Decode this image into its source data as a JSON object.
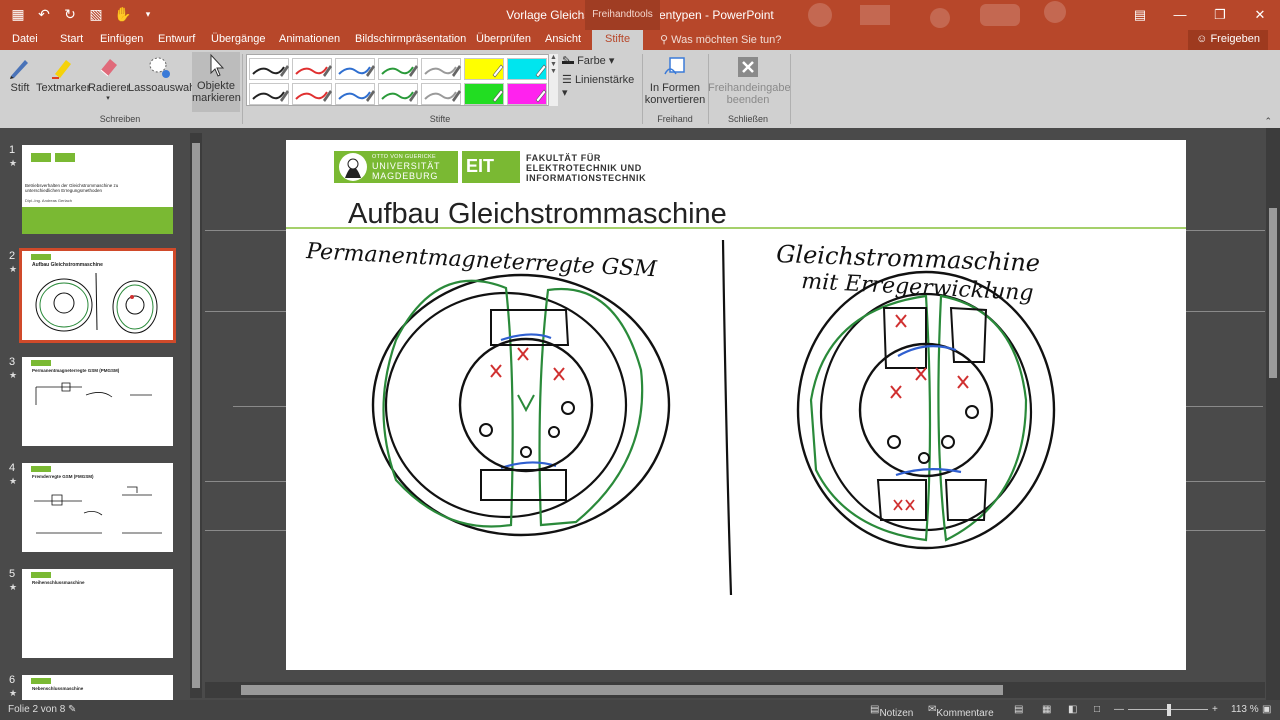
{
  "window": {
    "title": "Vorlage Gleichstrommaschinentypen  -  PowerPoint",
    "context_tab": "Freihandtools"
  },
  "menu": {
    "tabs": [
      "Datei",
      "Start",
      "Einfügen",
      "Entwurf",
      "Übergänge",
      "Animationen",
      "Bildschirmpräsentation",
      "Überprüfen",
      "Ansicht",
      "Stifte"
    ],
    "active_tab": "Stifte",
    "tell_me": "Was möchten Sie tun?",
    "share": "Freigeben"
  },
  "ribbon": {
    "stift": "Stift",
    "textmarker": "Textmarker",
    "radierer": "Radierer",
    "lasso": "Lassoauswahl",
    "objekte_1": "Objekte",
    "objekte_2": "markieren",
    "group_schreiben": "Schreiben",
    "farbe": "Farbe",
    "linienstaerke": "Linienstärke",
    "group_stifte": "Stifte",
    "formen_1": "In Formen",
    "formen_2": "konvertieren",
    "group_freihand": "Freihand",
    "beenden_1": "Freihandeingabe",
    "beenden_2": "beenden",
    "group_schliessen": "Schließen"
  },
  "pen_colors": [
    "#222222",
    "#e03030",
    "#2f6fd0",
    "#2a9a3a",
    "#9a9a9a",
    "#ffff00",
    "#00e5ee",
    "#222222",
    "#e03030",
    "#2f6fd0",
    "#2a9a3a",
    "#9a9a9a",
    "#22dd22",
    "#ff22ee"
  ],
  "thumbnails": [
    {
      "num": "1",
      "star": "★",
      "text_1": "Betriebsverhalten der Gleichstrommaschine zu unterschiedlichen Erregungsmethoden",
      "text_2": "Dipl.-Ing. Andreas Gerlach"
    },
    {
      "num": "2",
      "star": "★",
      "text_1": "Aufbau Gleichstrommaschine"
    },
    {
      "num": "3",
      "star": "★",
      "text_1": "Permanentmagneterregte GSM (PMGSM)"
    },
    {
      "num": "4",
      "star": "★",
      "text_1": "Fremderregte GSM (FMGSM)"
    },
    {
      "num": "5",
      "star": "★",
      "text_1": "Reihenschlussmaschine"
    },
    {
      "num": "6",
      "star": "★",
      "text_1": "Nebenschlussmaschine"
    }
  ],
  "slide": {
    "title": "Aufbau Gleichstrommaschine",
    "logo_university_1": "OTTO VON GUERICKE",
    "logo_university_2": "UNIVERSITÄT",
    "logo_university_3": "MAGDEBURG",
    "logo_eit": "EIT",
    "faculty_1": "FAKULTÄT FÜR",
    "faculty_2": "ELEKTROTECHNIK UND",
    "faculty_3": "INFORMATIONSTECHNIK",
    "handwriting_left": "Permanentmagneterregte GSM",
    "handwriting_right_1": "Gleichstrommaschine",
    "handwriting_right_2": "mit Erregerwicklung"
  },
  "status": {
    "slide_of": "Folie 2 von 8",
    "notes": "Notizen",
    "comments": "Kommentare",
    "zoom": "113 %"
  },
  "colors": {
    "accent": "#b7472a",
    "green_brand": "#7ab933"
  }
}
